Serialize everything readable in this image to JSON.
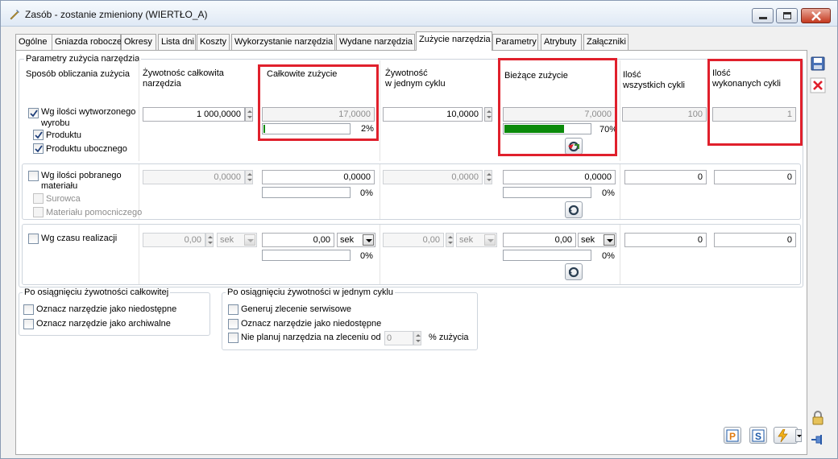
{
  "window": {
    "title": "Zasób - zostanie zmieniony  (WIERTŁO_A)"
  },
  "tabs": [
    "Ogólne",
    "Gniazda robocze",
    "Okresy",
    "Lista dni",
    "Koszty",
    "Wykorzystanie narzędzia",
    "Wydane narzędzia",
    "Zużycie narzędzia",
    "Parametry",
    "Atrybuty",
    "Załączniki"
  ],
  "active_tab": "Zużycie narzędzia",
  "params_group": {
    "legend": "Parametry zużycia narzędzia",
    "headers": {
      "method": "Sposób obliczania zużycia",
      "total_life_1": "Żywotnośc całkowita",
      "total_life_2": "narzędzia",
      "total_usage": "Całkowite zużycie",
      "cycle_life_1": "Żywotność",
      "cycle_life_2": "w jednym cyklu",
      "current_usage": "Bieżące zużycie",
      "all_cycles_1": "Ilość",
      "all_cycles_2": "wszystkich cykli",
      "done_cycles_1": "Ilość",
      "done_cycles_2": "wykonanych cykli"
    },
    "row_output": {
      "label_1": "Wg ilości wytworzonego",
      "label_2": "wyrobu",
      "checked": true,
      "sub1": "Produktu",
      "sub1_checked": true,
      "sub2": "Produktu ubocznego",
      "sub2_checked": true,
      "total_life": "1 000,0000",
      "total_usage": "17,0000",
      "total_usage_pct": "2%",
      "total_usage_ratio": 0.02,
      "cycle_life": "10,0000",
      "current_usage": "7,0000",
      "current_usage_pct": "70%",
      "current_usage_ratio": 0.7,
      "all_cycles": "100",
      "done_cycles": "1"
    },
    "row_material": {
      "label_1": "Wg ilości pobranego",
      "label_2": "materiału",
      "checked": false,
      "sub1": "Surowca",
      "sub2": "Materiału pomocniczego",
      "total_life": "0,0000",
      "total_usage": "0,0000",
      "total_usage_pct": "0%",
      "cycle_life": "0,0000",
      "current_usage": "0,0000",
      "current_usage_pct": "0%",
      "all_cycles": "0",
      "done_cycles": "0"
    },
    "row_time": {
      "label": "Wg czasu realizacji",
      "checked": false,
      "total_life": "0,00",
      "total_life_unit": "sek",
      "total_usage": "0,00",
      "total_usage_unit": "sek",
      "total_usage_pct": "0%",
      "cycle_life": "0,00",
      "cycle_life_unit": "sek",
      "current_usage": "0,00",
      "current_usage_unit": "sek",
      "current_usage_pct": "0%",
      "all_cycles": "0",
      "done_cycles": "0"
    }
  },
  "total_life_group": {
    "legend": "Po osiągnięciu żywotności całkowitej",
    "opt1": "Oznacz narzędzie jako niedostępne",
    "opt2": "Oznacz narzędzie jako archiwalne"
  },
  "cycle_life_group": {
    "legend": "Po osiągnięciu żywotności w jednym cyklu",
    "opt1": "Generuj zlecenie serwisowe",
    "opt2": "Oznacz narzędzie jako niedostępne",
    "opt3": "Nie planuj narzędzia na zleceniu od",
    "opt3_value": "0",
    "opt3_suffix": "% zużycia"
  },
  "colors": {
    "highlight": "#e0202c",
    "progress": "#0b8a0b"
  },
  "icons": [
    "save-icon",
    "cancel-icon",
    "lock-icon",
    "pin-icon",
    "p-icon",
    "s-icon",
    "lightning-icon",
    "reset-icon"
  ]
}
